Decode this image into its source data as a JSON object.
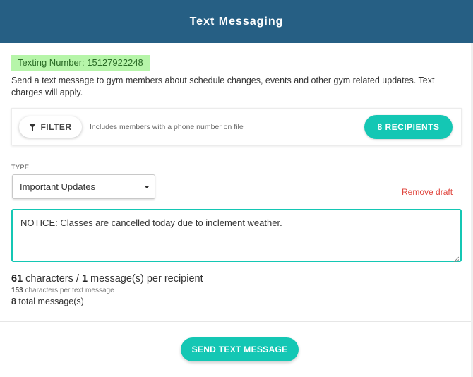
{
  "header": {
    "title": "Text Messaging"
  },
  "texting_number": "Texting Number: 15127922248",
  "description": "Send a text message to gym members about schedule changes, events and other gym related updates. Text charges will apply.",
  "filter": {
    "button_label": "FILTER",
    "note": "Includes members with a phone number on file",
    "recipients_label": "8 RECIPIENTS"
  },
  "type": {
    "label": "TYPE",
    "selected": "Important Updates"
  },
  "remove_draft": "Remove draft",
  "message": {
    "value": "NOTICE: Classes are cancelled today due to inclement weather."
  },
  "stats": {
    "characters": "61",
    "characters_text": " characters / ",
    "messages": "1",
    "messages_text": " message(s) per recipient",
    "per_text_count": "153",
    "per_text_label": " characters per text message",
    "total": "8",
    "total_label": " total message(s)"
  },
  "send_button": "SEND TEXT MESSAGE",
  "colors": {
    "header_bg": "#265f84",
    "accent": "#14c7b4",
    "texting_badge_bg": "#b6f5a9",
    "danger": "#e0463e"
  }
}
